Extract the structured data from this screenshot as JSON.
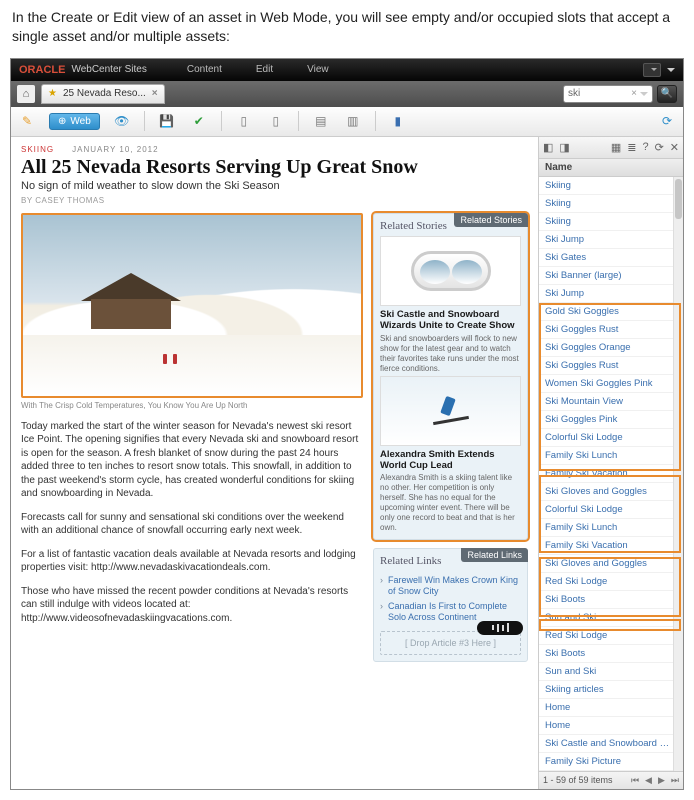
{
  "caption": "In the Create or Edit view of an asset in Web Mode, you will see empty and/or occupied slots that accept a single asset and/or multiple assets:",
  "brand": {
    "name": "ORACLE",
    "product": "WebCenter Sites"
  },
  "topmenu": [
    "Content",
    "Edit",
    "View"
  ],
  "tab": {
    "title": "25 Nevada Reso...",
    "close": "×"
  },
  "search": {
    "value": "ski",
    "clear": "×"
  },
  "whitebar": {
    "mode_label": "Web"
  },
  "article": {
    "category": "SKIING",
    "date": "JANUARY 10, 2012",
    "title": "All 25 Nevada Resorts Serving Up Great Snow",
    "subtitle": "No sign of mild weather to slow down the Ski Season",
    "byline": "BY  CASEY THOMAS",
    "image_caption": "With The Crisp Cold Temperatures, You Know You Are Up North",
    "p1": "Today marked the start of the winter season for Nevada's newest ski resort Ice Point. The opening signifies that every Nevada ski and snowboard resort is open for the season. A fresh blanket of snow during the past 24 hours added three to ten inches to resort snow totals. This snowfall, in addition to the past weekend's storm cycle, has created wonderful conditions for skiing and snowboarding in Nevada.",
    "p2": "Forecasts call for sunny and sensational ski conditions over the weekend with an additional chance of snowfall occurring early next week.",
    "p3": "For a list of fantastic vacation deals available at Nevada resorts and lodging properties visit: http://www.nevadaskivacationdeals.com.",
    "p4": "Those who have missed the recent powder conditions at Nevada's resorts can still indulge with videos located at: http://www.videosofnevadaskiingvacations.com."
  },
  "related_stories": {
    "panel_label": "Related Stories",
    "heading": "Related Stories",
    "items": [
      {
        "title": "Ski Castle and Snowboard Wizards Unite to Create Show",
        "text": "Ski and snowboarders will flock to new show for the latest gear and to watch their favorites take runs under the most fierce conditions."
      },
      {
        "title": "Alexandra Smith Extends World Cup Lead",
        "text": "Alexandra Smith is a skiing talent like no other. Her competition is only herself. She has no equal for the upcoming winter event. There will be only one record to beat and that is her own."
      }
    ]
  },
  "related_links": {
    "panel_label": "Related Links",
    "heading": "Related Links",
    "items": [
      "Farewell Win Makes Crown King of Snow City",
      "Canadian Is First to Complete Solo Across Continent"
    ],
    "dropzone": "[ Drop Article #3 Here ]"
  },
  "sidepanel": {
    "header": "Name",
    "items": [
      "Skiing",
      "Skiing",
      "Skiing",
      "Ski Jump",
      "Ski Gates",
      "Ski Banner (large)",
      "Ski Jump",
      "Gold Ski Goggles",
      "Ski Goggles Rust",
      "Ski Goggles Orange",
      "Ski Goggles Rust",
      "Women Ski Goggles Pink",
      "Ski Mountain View",
      "Ski Goggles Pink",
      "Colorful Ski Lodge",
      "Family Ski Lunch",
      "Family Ski Vacation",
      "Ski Gloves and Goggles",
      "Colorful Ski Lodge",
      "Family Ski Lunch",
      "Family Ski Vacation",
      "Ski Gloves and Goggles",
      "Red Ski Lodge",
      "Ski Boots",
      "Sun and Ski",
      "Red Ski Lodge",
      "Ski Boots",
      "Sun and Ski",
      "Skiing articles",
      "Home",
      "Home",
      "Ski Castle and Snowboard Wizards Unite",
      "Family Ski Picture"
    ],
    "footer": "1 - 59 of 59 items"
  }
}
